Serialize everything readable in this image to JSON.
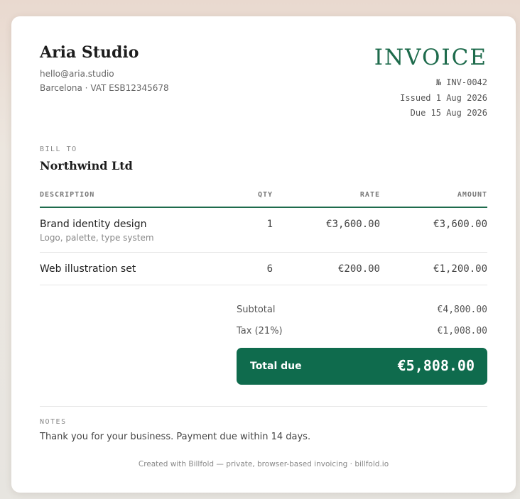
{
  "seller": {
    "name": "Aria Studio",
    "email": "hello@aria.studio",
    "address": "Barcelona · VAT ESB12345678"
  },
  "invoice": {
    "title": "INVOICE",
    "number": "№ INV-0042",
    "issued": "Issued 1 Aug 2026",
    "due": "Due 15 Aug 2026"
  },
  "bill_to": {
    "label": "BILL TO",
    "name": "Northwind Ltd"
  },
  "table": {
    "headers": {
      "description": "DESCRIPTION",
      "qty": "QTY",
      "rate": "RATE",
      "amount": "AMOUNT"
    },
    "rows": [
      {
        "title": "Brand identity design",
        "subtitle": "Logo, palette, type system",
        "qty": "1",
        "rate": "€3,600.00",
        "amount": "€3,600.00"
      },
      {
        "title": "Web illustration set",
        "subtitle": "",
        "qty": "6",
        "rate": "€200.00",
        "amount": "€1,200.00"
      }
    ]
  },
  "totals": {
    "subtotal_label": "Subtotal",
    "subtotal_value": "€4,800.00",
    "tax_label": "Tax (21%)",
    "tax_value": "€1,008.00",
    "total_label": "Total due",
    "total_value": "€5,808.00"
  },
  "notes": {
    "label": "NOTES",
    "text": "Thank you for your business. Payment due within 14 days."
  },
  "footer": {
    "text": "Created with Billfold — private, browser-based invoicing · billfold.io"
  },
  "colors": {
    "accent": "#1e6b4c",
    "total_bg": "#0f6b4d"
  }
}
